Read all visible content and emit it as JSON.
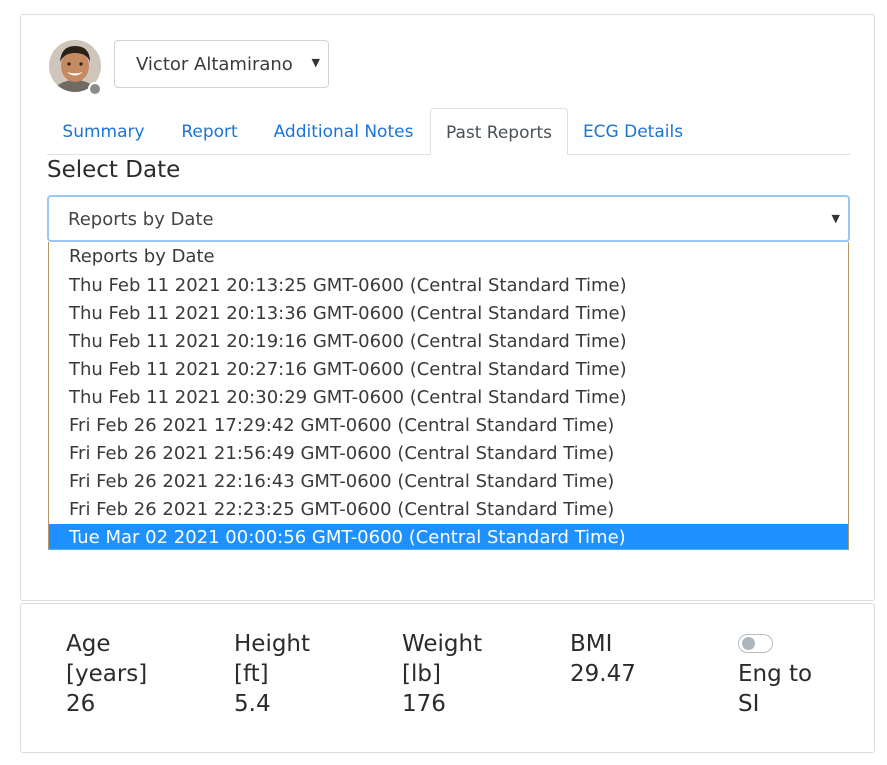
{
  "user": {
    "name": "Victor Altamirano",
    "avatar_icon": "person-avatar",
    "status_color": "#8a8a8a"
  },
  "tabs": [
    {
      "label": "Summary",
      "active": false
    },
    {
      "label": "Report",
      "active": false
    },
    {
      "label": "Additional Notes",
      "active": false
    },
    {
      "label": "Past Reports",
      "active": true
    },
    {
      "label": "ECG Details",
      "active": false
    }
  ],
  "date_select": {
    "label": "Select Date",
    "value": "Reports by Date",
    "options": [
      "Reports by Date",
      "Thu Feb 11 2021 20:13:25 GMT-0600 (Central Standard Time)",
      "Thu Feb 11 2021 20:13:36 GMT-0600 (Central Standard Time)",
      "Thu Feb 11 2021 20:19:16 GMT-0600 (Central Standard Time)",
      "Thu Feb 11 2021 20:27:16 GMT-0600 (Central Standard Time)",
      "Thu Feb 11 2021 20:30:29 GMT-0600 (Central Standard Time)",
      "Fri Feb 26 2021 17:29:42 GMT-0600 (Central Standard Time)",
      "Fri Feb 26 2021 21:56:49 GMT-0600 (Central Standard Time)",
      "Fri Feb 26 2021 22:16:43 GMT-0600 (Central Standard Time)",
      "Fri Feb 26 2021 22:23:25 GMT-0600 (Central Standard Time)",
      "Tue Mar 02 2021 00:00:56 GMT-0600 (Central Standard Time)"
    ],
    "highlighted": "Tue Mar 02 2021 00:00:56 GMT-0600 (Central Standard Time)"
  },
  "stats": {
    "age": {
      "label": "Age",
      "unit": "[years]",
      "value": "26"
    },
    "height": {
      "label": "Height",
      "unit": "[ft]",
      "value": "5.4"
    },
    "weight": {
      "label": "Weight",
      "unit": "[lb]",
      "value": "176"
    },
    "bmi": {
      "label": "BMI",
      "value": "29.47"
    }
  },
  "unit_toggle": {
    "line1": "Eng to",
    "line2": "SI",
    "on": false
  },
  "colors": {
    "link": "#1a73d9",
    "highlight": "#1e90ff",
    "focus_border": "#9dc7f3"
  }
}
